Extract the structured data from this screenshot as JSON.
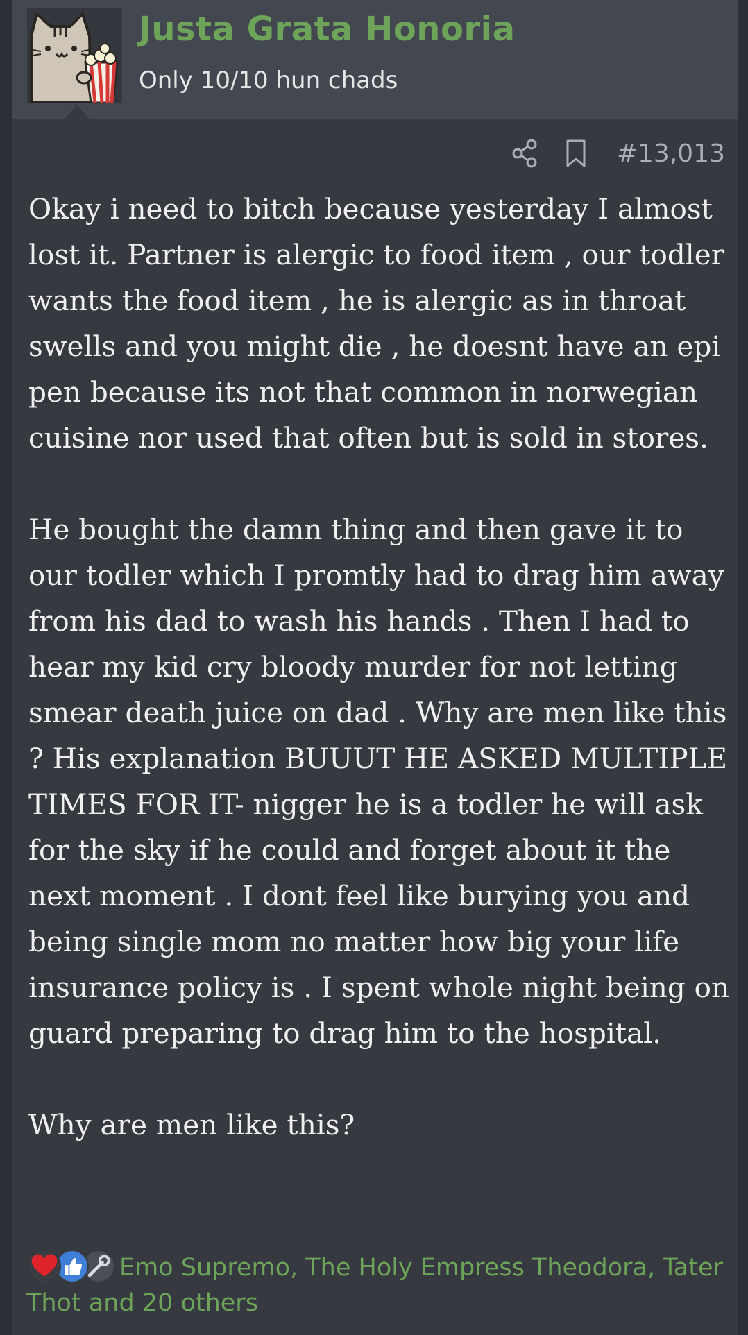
{
  "post": {
    "author": {
      "name": "Justa Grata Honoria",
      "title": "Only 10/10 hun chads",
      "avatar": "pusheen-cat-popcorn-avatar"
    },
    "actions": {
      "share_icon": "share-icon",
      "bookmark_icon": "bookmark-icon",
      "post_number": "#13,013"
    },
    "body": {
      "paragraphs": [
        "Okay i need to bitch because yesterday I almost lost it. Partner is alergic to food item , our todler wants the food item , he is alergic as in throat swells and you might die , he doesnt have an epi pen because its not that common in norwegian cuisine nor used that often but is sold in stores.",
        "He bought the damn thing and then gave it to our todler which I promtly had to drag him away from his dad to wash his hands . Then I had to hear my kid cry bloody murder for not letting smear death juice on dad . Why are men like this ? His explanation BUUUT HE ASKED MULTIPLE TIMES FOR IT- nigger he is a todler he will ask for the sky if he could and forget about it the next moment . I dont feel like burying you and being single mom no matter how big your life insurance policy is . I spent whole night being on guard preparing to drag him to the hospital.",
        "Why are men like this?"
      ]
    },
    "reactions": {
      "icons": [
        "heart-icon",
        "like-icon",
        "tool-icon"
      ],
      "colors": {
        "heart": "#e0242b",
        "like": "#3f7fd6",
        "names": "#6da459"
      },
      "summary": "Emo Supremo, The Holy Empress Theodora, Tater Thot and 20 others"
    }
  }
}
